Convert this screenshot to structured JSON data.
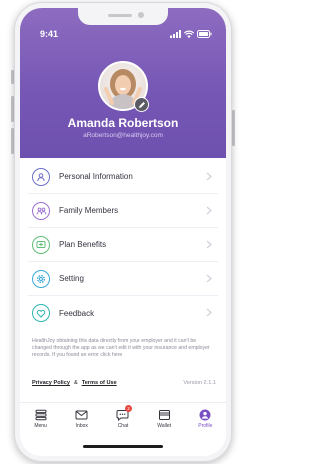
{
  "status_bar": {
    "time": "9:41"
  },
  "profile": {
    "name": "Amanda Robertson",
    "email": "aRobertson@healthjoy.com"
  },
  "menu": {
    "items": [
      {
        "label": "Personal Information",
        "icon": "person-icon",
        "color": "#6d6fc9"
      },
      {
        "label": "Family Members",
        "icon": "family-icon",
        "color": "#9a6fd4"
      },
      {
        "label": "Plan Benefits",
        "icon": "plan-card-icon",
        "color": "#5fbf78"
      },
      {
        "label": "Setting",
        "icon": "gear-icon",
        "color": "#3aa9d9"
      },
      {
        "label": "Feedback",
        "icon": "heart-icon",
        "color": "#2fb6b0"
      }
    ]
  },
  "disclaimer": "HealthJoy obtaining this data directly from your employer and it can't be changed through the app as we can't edit it with your insurance and employer records. If you found an error  click here",
  "links": {
    "privacy": "Privacy Policy",
    "amp": "&",
    "terms": "Terms of Use",
    "version": "Version 2.1.1"
  },
  "tabbar": {
    "tabs": [
      {
        "label": "Menu",
        "icon": "menu-icon",
        "active": false
      },
      {
        "label": "Inbox",
        "icon": "envelope-icon",
        "active": false
      },
      {
        "label": "Chat",
        "icon": "chat-icon",
        "active": false,
        "badge": "2"
      },
      {
        "label": "Wallet",
        "icon": "wallet-icon",
        "active": false
      },
      {
        "label": "Profile",
        "icon": "profile-icon",
        "active": true
      }
    ]
  },
  "colors": {
    "brand_purple": "#7657b5",
    "active_tab": "#7a4fc4",
    "badge_red": "#e6463f"
  }
}
